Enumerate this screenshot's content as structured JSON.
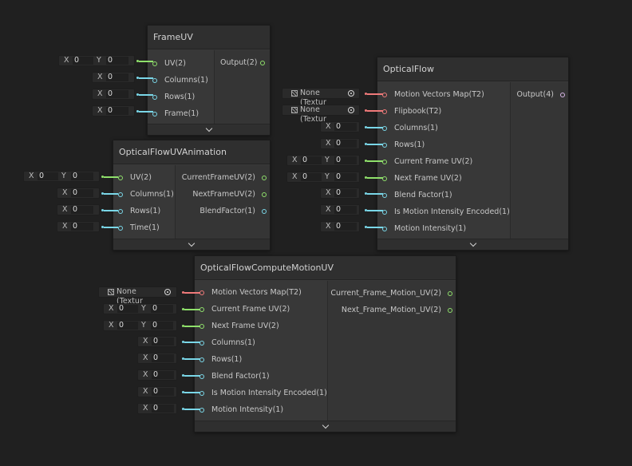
{
  "nodes": {
    "frame_uv": {
      "title": "FrameUV",
      "inputs": [
        "UV(2)",
        "Columns(1)",
        "Rows(1)",
        "Frame(1)"
      ],
      "outputs": [
        "Output(2)"
      ]
    },
    "ofuv_anim": {
      "title": "OpticalFlowUVAnimation",
      "inputs": [
        "UV(2)",
        "Columns(1)",
        "Rows(1)",
        "Time(1)"
      ],
      "outputs": [
        "CurrentFrameUV(2)",
        "NextFrameUV(2)",
        "BlendFactor(1)"
      ]
    },
    "optical_flow": {
      "title": "OpticalFlow",
      "inputs": [
        "Motion Vectors Map(T2)",
        "Flipbook(T2)",
        "Columns(1)",
        "Rows(1)",
        "Current Frame UV(2)",
        "Next Frame UV(2)",
        "Blend Factor(1)",
        "Is Motion Intensity Encoded(1)",
        "Motion Intensity(1)"
      ],
      "outputs": [
        "Output(4)"
      ]
    },
    "compute_motion": {
      "title": "OpticalFlowComputeMotionUV",
      "inputs": [
        "Motion Vectors Map(T2)",
        "Current Frame UV(2)",
        "Next Frame UV(2)",
        "Columns(1)",
        "Rows(1)",
        "Blend Factor(1)",
        "Is Motion Intensity Encoded(1)",
        "Motion Intensity(1)"
      ],
      "outputs": [
        "Current_Frame_Motion_UV(2)",
        "Next_Frame_Motion_UV(2)"
      ]
    }
  },
  "fields": {
    "x_label": "X",
    "y_label": "Y",
    "zero": "0",
    "texture_none": "None (Textur"
  }
}
